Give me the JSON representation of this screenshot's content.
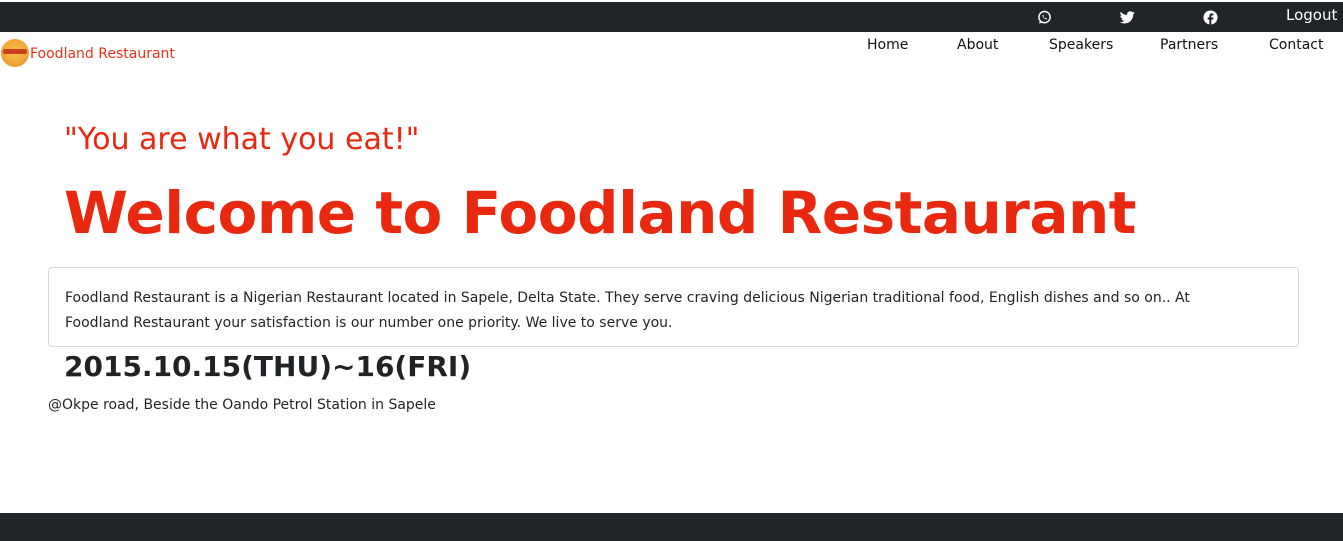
{
  "topbar": {
    "social_icons": [
      "whatsapp-icon",
      "twitter-icon",
      "facebook-icon"
    ],
    "logout_label": "Logout"
  },
  "navbar": {
    "brand_name": "Foodland Restaurant",
    "links": [
      "Home",
      "About",
      "Speakers",
      "Partners",
      "Contact"
    ]
  },
  "hero": {
    "quote": "\"You are what you eat!\"",
    "title": "Welcome to Foodland Restaurant",
    "description": "Foodland Restaurant is a Nigerian Restaurant located in Sapele, Delta State. They serve craving delicious Nigerian traditional food, English dishes and so on.. At Foodland Restaurant your satisfaction is our number one priority. We live to serve you.",
    "date": "2015.10.15(THU)~16(FRI)",
    "address": "@Okpe road, Beside the Oando Petrol Station in Sapele"
  },
  "colors": {
    "accent": "#e8290f",
    "dark_bar": "#212529"
  }
}
